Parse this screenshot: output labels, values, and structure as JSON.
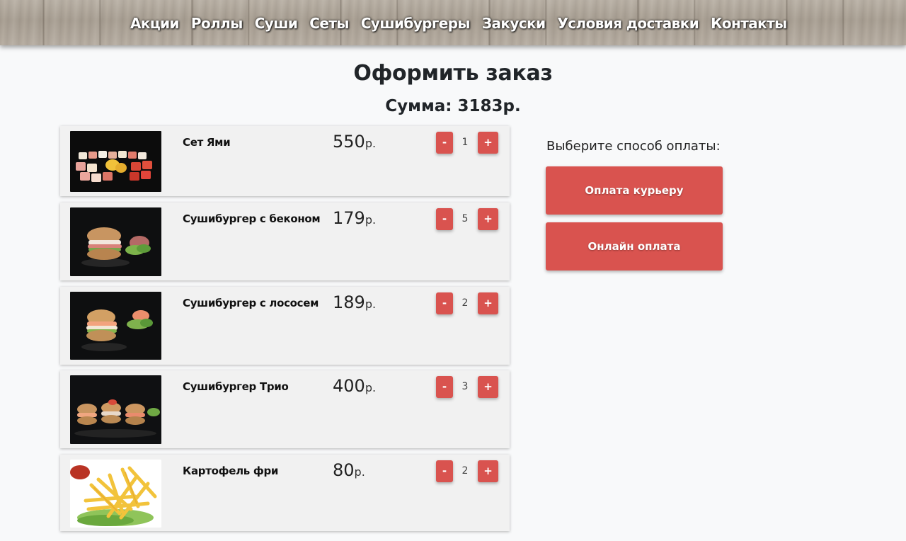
{
  "nav": {
    "items": [
      "Акции",
      "Роллы",
      "Суши",
      "Сеты",
      "Сушибургеры",
      "Закуски",
      "Условия доставки",
      "Контакты"
    ]
  },
  "page": {
    "title": "Оформить заказ",
    "sum_label": "Сумма: 3183р."
  },
  "cart": {
    "currency": "р.",
    "minus_label": "-",
    "plus_label": "+",
    "items": [
      {
        "name": "Сет Ями",
        "price": "550",
        "qty": "1"
      },
      {
        "name": "Сушибургер с беконом",
        "price": "179",
        "qty": "5"
      },
      {
        "name": "Сушибургер с лососем",
        "price": "189",
        "qty": "2"
      },
      {
        "name": "Сушибургер Трио",
        "price": "400",
        "qty": "3"
      },
      {
        "name": "Картофель фри",
        "price": "80",
        "qty": "2"
      }
    ]
  },
  "payment": {
    "title": "Выберите способ оплаты:",
    "courier_label": "Оплата курьеру",
    "online_label": "Онлайн оплата"
  },
  "colors": {
    "accent": "#d9534f",
    "card_bg": "#f1f1f1",
    "page_bg": "#f8f9fa"
  }
}
